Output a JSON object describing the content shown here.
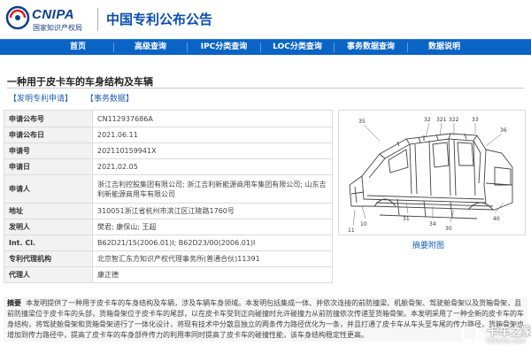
{
  "header": {
    "logo_en": "CNIPA",
    "logo_cn": "国家知识产权局",
    "site_title": "中国专利公布公告"
  },
  "nav": {
    "items": [
      "首页",
      "高级查询",
      "IPC分类查询",
      "LOC分类查询",
      "事务数据查询",
      "数据说明"
    ]
  },
  "doc": {
    "title": "一种用于皮卡车的车身结构及车辆",
    "link_publication": "【发明专利申请】",
    "link_transaction": "【事务数据】"
  },
  "info": {
    "rows": [
      {
        "key": "申请公布号",
        "value": "CN112937686A"
      },
      {
        "key": "申请公布日",
        "value": "2021.06.11"
      },
      {
        "key": "申请号",
        "value": "202110159941X"
      },
      {
        "key": "申请日",
        "value": "2021.02.05"
      },
      {
        "key": "申请人",
        "value": "浙江吉利控股集团有限公司; 浙江吉利新能源商用车集团有限公司; 山东吉利新能源商用车有限公司"
      },
      {
        "key": "地址",
        "value": "310051浙江省杭州市滨江区江陵路1760号"
      },
      {
        "key": "发明人",
        "value": "樊君; 康保山; 王超"
      },
      {
        "key": "Int. Cl.",
        "value": "B62D21/15(2006.01)I; B62D23/00(2006.01)I"
      },
      {
        "key": "专利代理机构",
        "value": "北京智汇东方知识产权代理事务所(普通合伙)11391"
      },
      {
        "key": "代理人",
        "value": "康正德"
      }
    ]
  },
  "figure": {
    "caption": "摘要附图",
    "labels": [
      "35",
      "32",
      "321",
      "322",
      "33",
      "36",
      "31",
      "34",
      "30",
      "40",
      "10",
      "11"
    ]
  },
  "abstract": {
    "label": "摘要",
    "text": "本发明提供了一种用于皮卡车的车身结构及车辆，涉及车辆车身领域。本发明包括集成一体、并依次连接的前防撞梁、机舱骨架、驾驶舱骨架以及货箱骨架，且前防撞梁位于皮卡车的头部，货箱骨架位于皮卡车的尾部，以在皮卡车受到正向碰撞时允许碰撞力从前防撞依次传递至货箱骨架。本发明采用了一种全新的皮卡车的车身结构，将驾驶舱骨架和货箱骨架进行了一体化设计，将现有技术中分散且独立的两条传力路径优化为一条，并且打通了皮卡车从车头至车尾的传力路径，货箱骨架也增加到传力路径中，提高了皮卡车的车身部件传力的利用率同时提高了皮卡车的碰撞性能，该车身结构稳定性更高。"
  },
  "watermark": {
    "text": "卡车之家",
    "sub": "360che.com"
  }
}
